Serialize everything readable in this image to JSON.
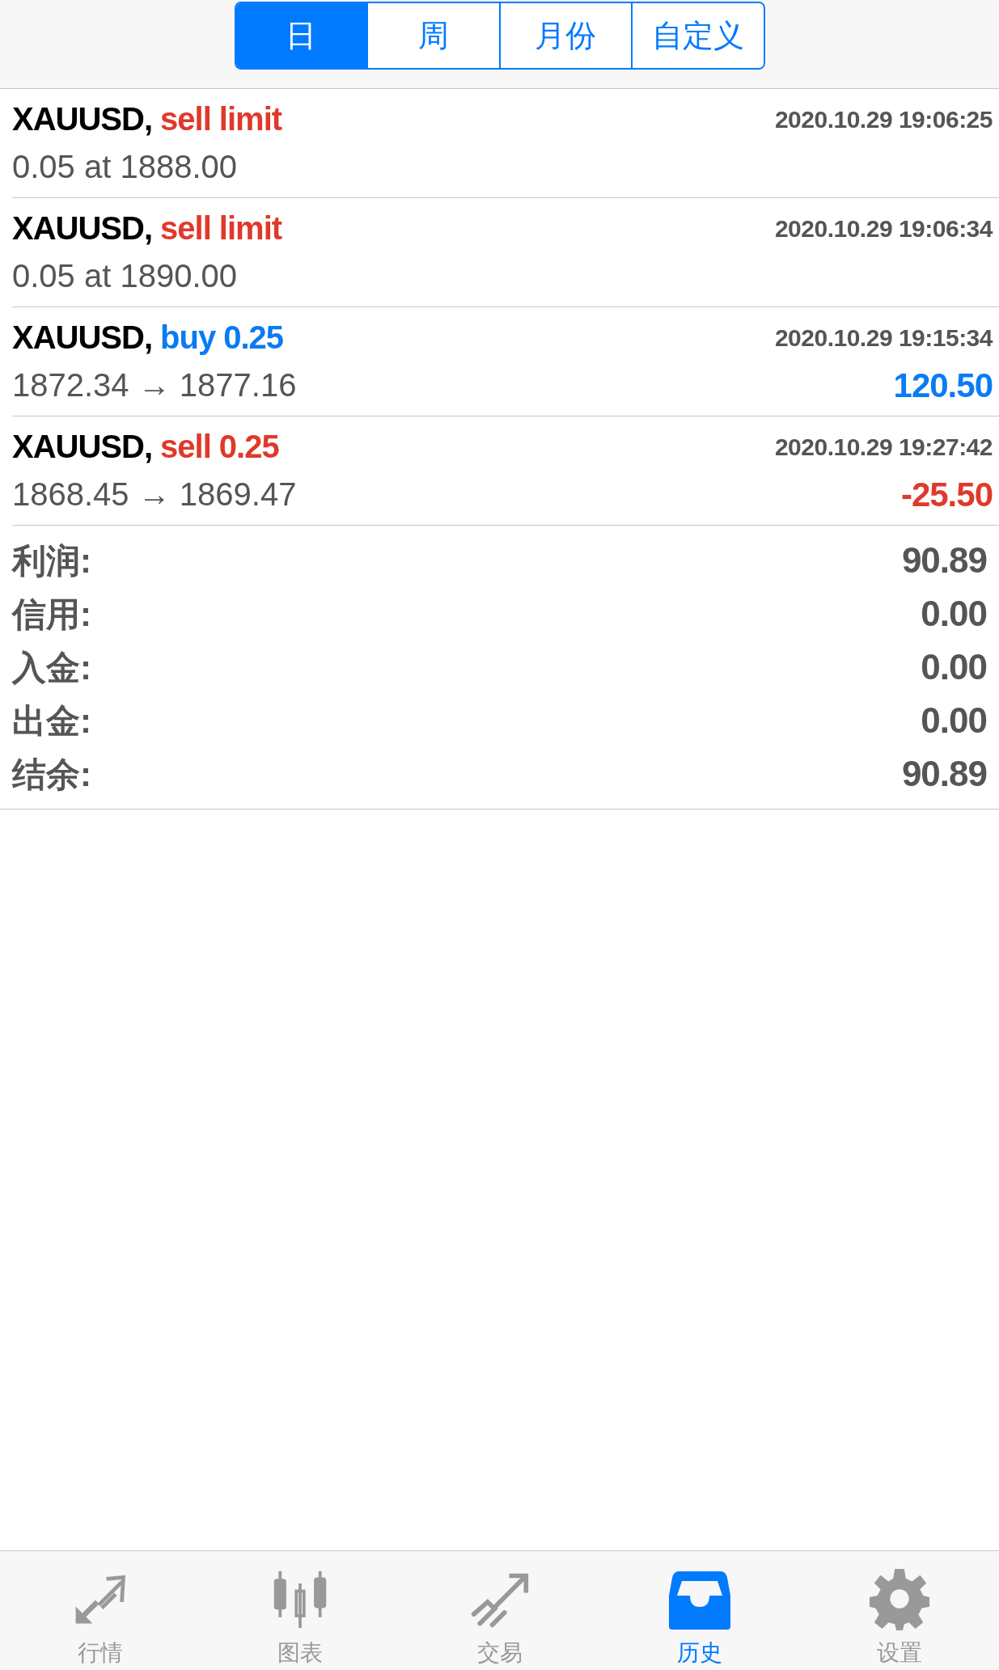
{
  "periods": [
    {
      "label": "日",
      "selected": true
    },
    {
      "label": "周",
      "selected": false
    },
    {
      "label": "月份",
      "selected": false
    },
    {
      "label": "自定义",
      "selected": false
    }
  ],
  "trades": [
    {
      "symbol": "XAUUSD,",
      "color": "#e0392b",
      "action": "sell limit",
      "time": "2020.10.29 19:06:25",
      "detail": "0.05 at 1888.00"
    },
    {
      "symbol": "XAUUSD,",
      "color": "#e0392b",
      "action": "sell limit",
      "time": "2020.10.29 19:06:34",
      "detail": "0.05 at 1890.00"
    },
    {
      "symbol": "XAUUSD,",
      "color": "#0a7bf2",
      "action": "buy 0.25",
      "time": "2020.10.29 19:15:34",
      "detail": "1872.34 → 1877.16",
      "profit": "120.50"
    },
    {
      "symbol": "XAUUSD,",
      "color": "#e0392b",
      "action": "sell 0.25",
      "time": "2020.10.29 19:27:42",
      "detail": "1868.45 → 1869.47",
      "profit": "-25.50"
    }
  ],
  "summary": [
    {
      "label": "利润:",
      "value": "90.89"
    },
    {
      "label": "信用:",
      "value": "0.00"
    },
    {
      "label": "入金:",
      "value": "0.00"
    },
    {
      "label": "出金:",
      "value": "0.00"
    },
    {
      "label": "结余:",
      "value": "90.89"
    }
  ],
  "tab_bar": [
    {
      "label": "行情",
      "selected": false
    },
    {
      "label": "图表",
      "selected": false
    },
    {
      "label": "交易",
      "selected": false
    },
    {
      "label": "历史",
      "selected": true
    },
    {
      "label": "设置",
      "selected": false
    }
  ]
}
